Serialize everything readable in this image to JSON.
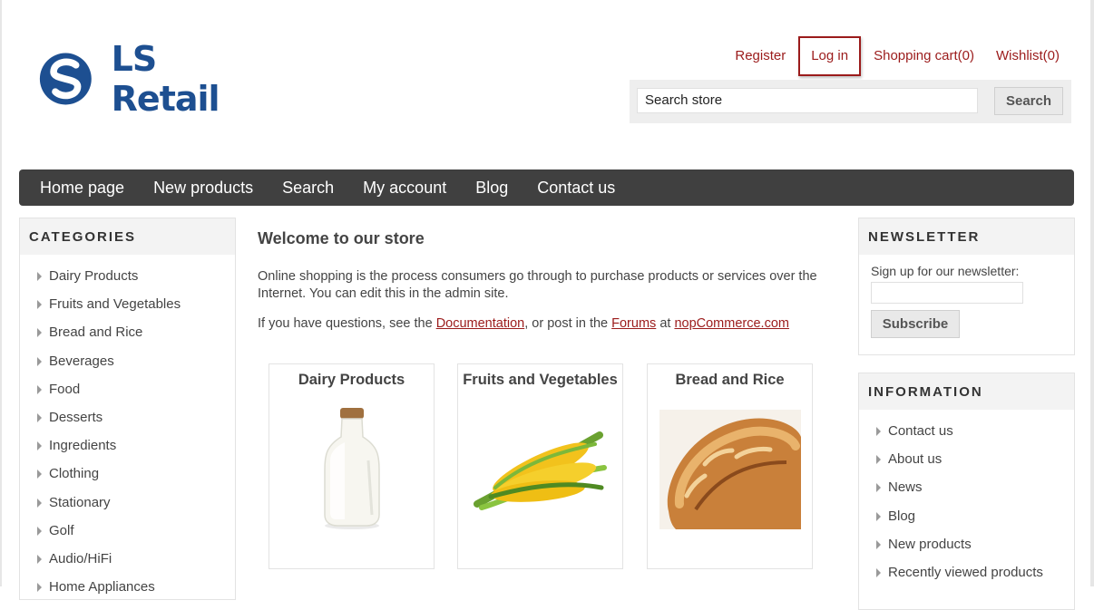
{
  "brand": {
    "logo_text": "LS Retail",
    "accent_color": "#1d4f91",
    "link_color": "#9b1b1b"
  },
  "header": {
    "links": [
      {
        "label": "Register"
      },
      {
        "label": "Log in"
      },
      {
        "label": "Shopping cart(0)"
      },
      {
        "label": "Wishlist(0)"
      }
    ],
    "search": {
      "value": "Search store",
      "button_label": "Search"
    }
  },
  "nav": {
    "items": [
      {
        "label": "Home page"
      },
      {
        "label": "New products"
      },
      {
        "label": "Search"
      },
      {
        "label": "My account"
      },
      {
        "label": "Blog"
      },
      {
        "label": "Contact us"
      }
    ]
  },
  "categories": {
    "title": "CATEGORIES",
    "items": [
      {
        "label": "Dairy Products"
      },
      {
        "label": "Fruits and Vegetables"
      },
      {
        "label": "Bread and Rice"
      },
      {
        "label": "Beverages"
      },
      {
        "label": "Food"
      },
      {
        "label": "Desserts"
      },
      {
        "label": "Ingredients"
      },
      {
        "label": "Clothing"
      },
      {
        "label": "Stationary"
      },
      {
        "label": "Golf"
      },
      {
        "label": "Audio/HiFi"
      },
      {
        "label": "Home Appliances"
      }
    ]
  },
  "main": {
    "title": "Welcome to our store",
    "intro": "Online shopping is the process consumers go through to purchase products or services over the Internet. You can edit this in the admin site.",
    "questions": {
      "prefix": "If you have questions, see the ",
      "documentation": "Documentation",
      "middle": ", or post in the ",
      "forums": "Forums",
      "at": " at ",
      "site": "nopCommerce.com"
    },
    "featured_categories": [
      {
        "title": "Dairy Products",
        "icon": "milk-bottle-image"
      },
      {
        "title": "Fruits and Vegetables",
        "icon": "corn-image"
      },
      {
        "title": "Bread and Rice",
        "icon": "bread-image"
      }
    ]
  },
  "newsletter": {
    "title": "NEWSLETTER",
    "label": "Sign up for our newsletter:",
    "input_value": "",
    "button_label": "Subscribe"
  },
  "information": {
    "title": "INFORMATION",
    "items": [
      {
        "label": "Contact us"
      },
      {
        "label": "About us"
      },
      {
        "label": "News"
      },
      {
        "label": "Blog"
      },
      {
        "label": "New products"
      },
      {
        "label": "Recently viewed products"
      }
    ]
  }
}
